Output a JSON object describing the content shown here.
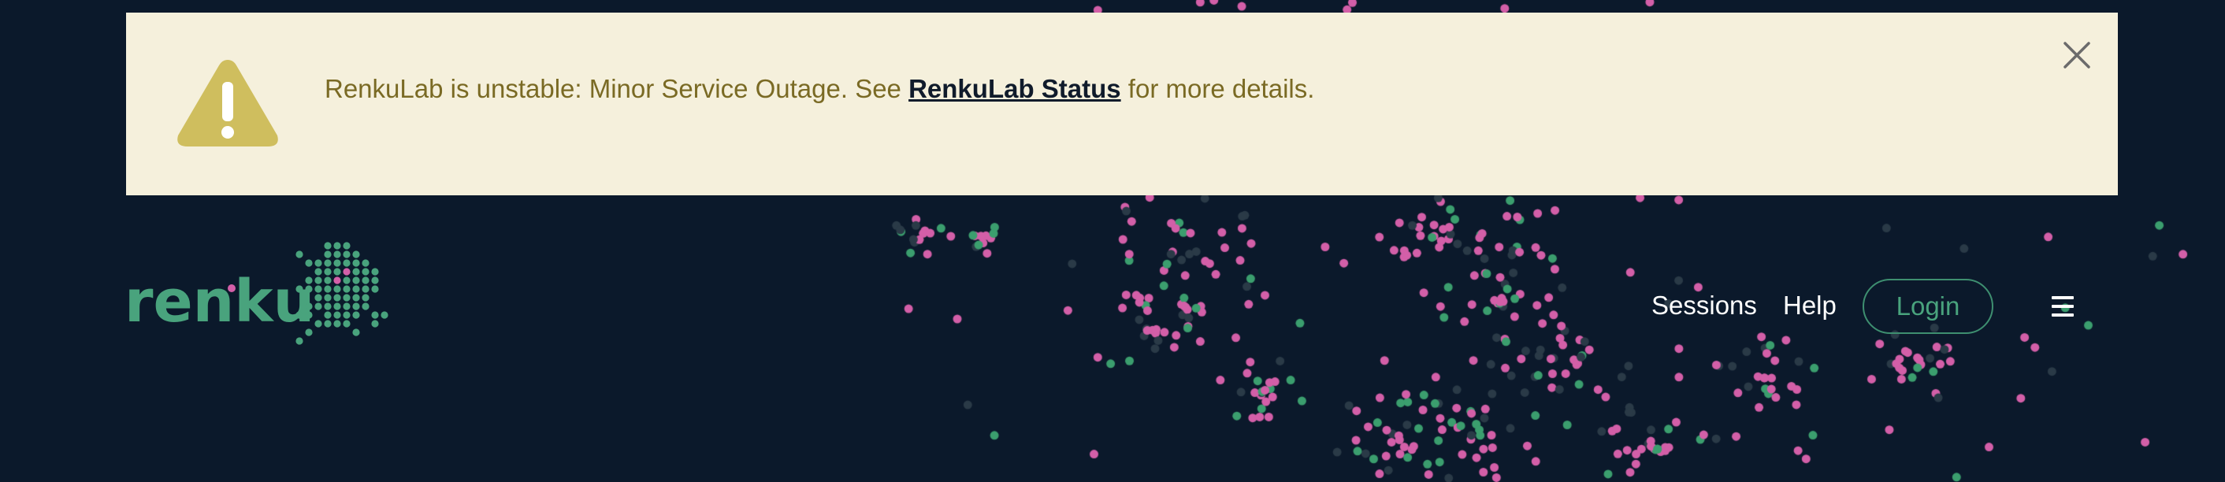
{
  "alert": {
    "message_prefix": "RenkuLab is unstable: Minor Service Outage. See ",
    "link_text": "RenkuLab Status",
    "message_suffix": " for more details.",
    "icon": "warning-triangle-icon",
    "close_icon": "close-icon",
    "background_color": "#f5f0dc",
    "text_color": "#7a6a24",
    "icon_color": "#cfbe5e"
  },
  "navbar": {
    "brand": "renku",
    "links": [
      {
        "label": "Sessions"
      },
      {
        "label": "Help"
      }
    ],
    "login_label": "Login",
    "menu_icon": "hamburger-menu-icon"
  },
  "colors": {
    "page_background": "#0b192b",
    "accent_green": "#49a37d",
    "accent_pink": "#d35fa8"
  }
}
